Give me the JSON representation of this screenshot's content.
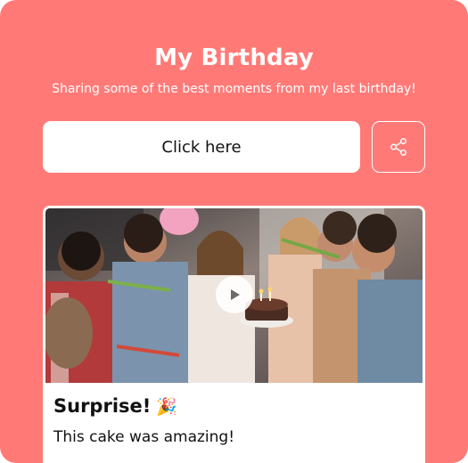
{
  "header": {
    "title": "My Birthday",
    "subtitle": "Sharing some of the best moments from my last birthday!"
  },
  "actions": {
    "cta_label": "Click here",
    "share_icon": "share-icon"
  },
  "post": {
    "media_icon": "play-icon",
    "title": "Surprise!",
    "title_emoji": "🎉",
    "text": "This cake was amazing!"
  },
  "colors": {
    "background": "#ff7a77",
    "button_bg": "#ffffff",
    "text_dark": "#111111"
  }
}
